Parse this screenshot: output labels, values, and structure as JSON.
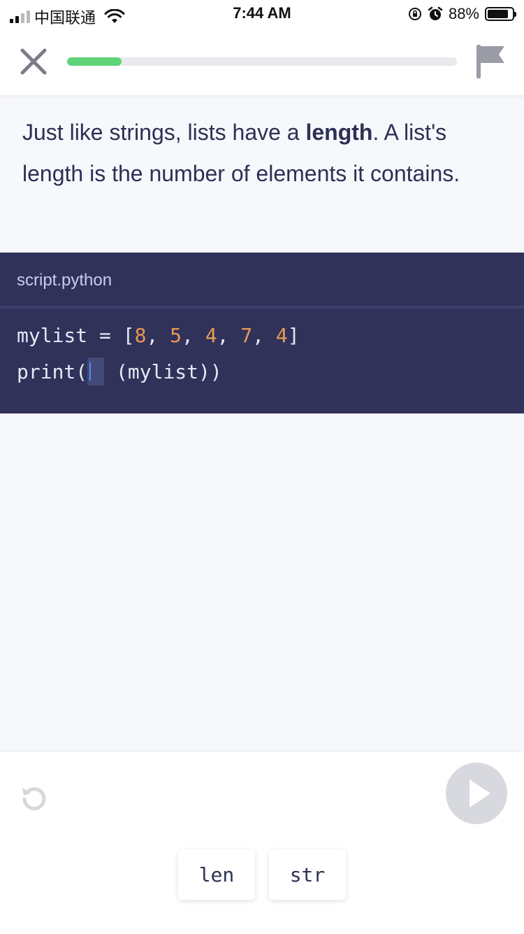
{
  "status_bar": {
    "carrier": "中国联通",
    "time": "7:44 AM",
    "battery_percent": "88%",
    "battery_level": 0.88,
    "icons": [
      "signal-icon",
      "wifi-icon",
      "rotation-lock-icon",
      "alarm-icon",
      "battery-icon"
    ]
  },
  "header": {
    "progress_value": 0.14,
    "progress_color": "#5fd377",
    "icons": [
      "close-icon",
      "flag-icon"
    ]
  },
  "lesson": {
    "text_before": "Just like strings, lists have a ",
    "text_bold": "length",
    "text_after": ". A list's length is the number of elements it contains."
  },
  "code_panel": {
    "filename": "script.python",
    "line1": {
      "prefix": "mylist = [",
      "numbers": [
        "8",
        "5",
        "4",
        "7",
        "4"
      ],
      "separator": ", ",
      "suffix": "]"
    },
    "line2": {
      "before_blank": "print(",
      "after_blank": " (mylist))"
    },
    "colors": {
      "background": "#30325a",
      "number": "#e89a55",
      "text": "#e6e8f5"
    }
  },
  "controls": {
    "icons": [
      "reset-icon",
      "play-icon"
    ]
  },
  "answer_options": [
    "len",
    "str"
  ]
}
